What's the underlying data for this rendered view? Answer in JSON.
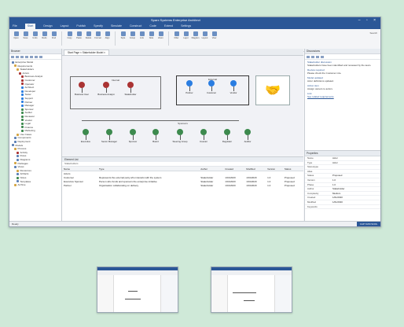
{
  "window": {
    "title": "Sparx Systems Enterprise Architect",
    "controls": "– ▫ ×",
    "menu": [
      "File",
      "Start",
      "Design",
      "Layout",
      "Publish",
      "Specify",
      "Simulate",
      "Construct",
      "Code",
      "Extend",
      "Settings"
    ],
    "ribbon_buttons": [
      "Open",
      "Save",
      "Undo",
      "Redo",
      "Find",
      "Copy",
      "Paste",
      "Delete",
      "Format",
      "Align",
      "Style",
      "Group",
      "Link",
      "Note",
      "Zoom",
      "Filter",
      "Layer",
      "Diagram",
      "Layout",
      "View"
    ],
    "ribbon_right": "Search"
  },
  "left_pane": {
    "header": "Browser",
    "tree": [
      {
        "label": "Enterprise Model",
        "color": "#5b7fb5"
      },
      {
        "label": "Requirements",
        "color": "#d4a441"
      },
      {
        "label": "Stakeholders",
        "color": "#d4a441"
      },
      {
        "label": "Actors",
        "color": "#a33"
      },
      {
        "label": "Business Analyst",
        "color": "#a33"
      },
      {
        "label": "Customer",
        "color": "#a33"
      },
      {
        "label": "Operator",
        "color": "#a33"
      },
      {
        "label": "Architect",
        "color": "#2a7de1"
      },
      {
        "label": "Developer",
        "color": "#2a7de1"
      },
      {
        "label": "Tester",
        "color": "#2a7de1"
      },
      {
        "label": "Support",
        "color": "#2a7de1"
      },
      {
        "label": "Partner",
        "color": "#2a7de1"
      },
      {
        "label": "Manager",
        "color": "#2a7de1"
      },
      {
        "label": "Sponsor",
        "color": "#3d8a4e"
      },
      {
        "label": "Auditor",
        "color": "#3d8a4e"
      },
      {
        "label": "Reviewer",
        "color": "#3d8a4e"
      },
      {
        "label": "Vendor",
        "color": "#3d8a4e"
      },
      {
        "label": "Legal",
        "color": "#3d8a4e"
      },
      {
        "label": "Finance",
        "color": "#3d8a4e"
      },
      {
        "label": "Marketing",
        "color": "#3d8a4e"
      },
      {
        "label": "Use Cases",
        "color": "#d4a441"
      },
      {
        "label": "Components",
        "color": "#5b7fb5"
      },
      {
        "label": "Deployment",
        "color": "#5b7fb5"
      },
      {
        "label": "Models",
        "color": "#5b7fb5"
      },
      {
        "label": "Process",
        "color": "#d4a441"
      },
      {
        "label": "Activity",
        "color": "#a33"
      },
      {
        "label": "Flows",
        "color": "#5b7fb5"
      },
      {
        "label": "Diagrams",
        "color": "#5b7fb5"
      },
      {
        "label": "Packages",
        "color": "#d4a441"
      },
      {
        "label": "Views",
        "color": "#5b7fb5"
      },
      {
        "label": "Resources",
        "color": "#d4a441"
      },
      {
        "label": "Artifacts",
        "color": "#5b7fb5"
      },
      {
        "label": "Notes",
        "color": "#3d8a4e"
      },
      {
        "label": "Templates",
        "color": "#5b7fb5"
      },
      {
        "label": "Archive",
        "color": "#d4a441"
      }
    ]
  },
  "center": {
    "tab": "Start Page  ×   Stakeholder Model  ×",
    "group1": {
      "title": "Internal",
      "actors": [
        "Business User",
        "Business Analyst",
        "Stakeholder"
      ],
      "color": "#a33"
    },
    "group2": {
      "title": "External",
      "actors": [
        "Partner",
        "Customer",
        "Vendor"
      ],
      "color": "#2a7de1"
    },
    "handshake_label": "Collaboration",
    "group3": {
      "title": "Sponsors",
      "actors": [
        "Executive",
        "Senior Manager",
        "Sponsor",
        "Board",
        "Steering Group",
        "Investor",
        "Regulator",
        "Auditor"
      ],
      "color": "#3d8a4e"
    }
  },
  "bottom_panel": {
    "title": "Element List",
    "subtitle": "Stakeholders",
    "columns": [
      "Name",
      "Type",
      "Author",
      "Created",
      "Modified",
      "Version",
      "Status"
    ],
    "rows": [
      [
        "Actors",
        "",
        "",
        "",
        "",
        "",
        ""
      ],
      [
        "Customer",
        "Represents the external party who interacts with the system",
        "Stakeholder",
        "1/01/2020",
        "1/01/2020",
        "1.0",
        "Proposed"
      ],
      [
        "Executive Sponsor",
        "Person who funds and sponsors the enterprise initiative",
        "Stakeholder",
        "1/01/2020",
        "1/01/2020",
        "1.0",
        "Proposed"
      ],
      [
        "Partner",
        "Organisation collaborating on delivery",
        "Stakeholder",
        "1/01/2020",
        "1/01/2020",
        "1.0",
        "Proposed"
      ]
    ]
  },
  "right_pane": {
    "header": "Discussions",
    "items": [
      {
        "title": "Stakeholder discussion",
        "text": "Stakeholders have been identified and reviewed by the team."
      },
      {
        "title": "Review required",
        "text": "Please check the Customer role."
      },
      {
        "title": "Model updated",
        "text": "Actor definitions updated."
      },
      {
        "title": "Action item",
        "text": "Assign owners to actors."
      },
      {
        "title": "Link",
        "text": "See related requirements"
      }
    ]
  },
  "properties": {
    "header": "Properties",
    "rows": [
      [
        "Name",
        "Actor"
      ],
      [
        "Type",
        "Actor"
      ],
      [
        "Stereotype",
        ""
      ],
      [
        "Alias",
        ""
      ],
      [
        "Status",
        "Proposed"
      ],
      [
        "Version",
        "1.0"
      ],
      [
        "Phase",
        "1.0"
      ],
      [
        "Author",
        "Stakeholder"
      ],
      [
        "Complexity",
        "Medium"
      ],
      [
        "Created",
        "1/01/2020"
      ],
      [
        "Modified",
        "1/01/2020"
      ],
      [
        "Keywords",
        ""
      ]
    ]
  },
  "status_bar": {
    "left": "Ready",
    "right": "CAP NUM SCRL"
  },
  "colors": {
    "accent": "#2b5797",
    "background": "#cfe9d8"
  }
}
